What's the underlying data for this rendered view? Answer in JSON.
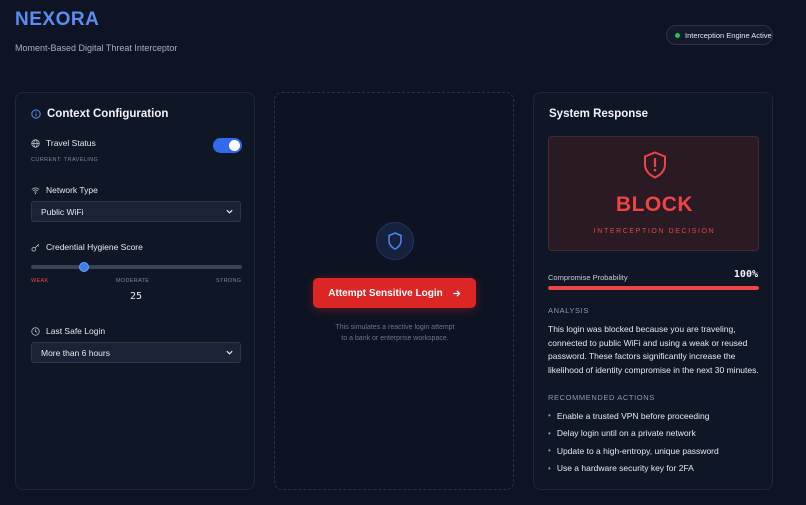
{
  "header": {
    "brand": "NEXORA",
    "tagline": "Moment-Based Digital Threat Interceptor",
    "status": "Interception Engine Active",
    "status_color": "#22c55e"
  },
  "context": {
    "title": "Context Configuration",
    "travel_label": "Travel Status",
    "travel_sub": "CURRENT: TRAVELING",
    "travel_on": true,
    "network_label": "Network Type",
    "network_value": "Public WiFi",
    "hygiene_label": "Credential Hygiene Score",
    "hygiene_score": "25",
    "hygiene_value": 25,
    "scale_weak": "WEAK",
    "scale_moderate": "MODERATE",
    "scale_strong": "STRONG",
    "last_login_label": "Last Safe Login",
    "last_login_value": "More than 6 hours"
  },
  "middle": {
    "button_label": "Attempt Sensitive Login",
    "hint": "This simulates a reactive login attempt to a bank or enterprise workspace."
  },
  "response": {
    "title": "System Response",
    "decision": "BLOCK",
    "decision_sub": "INTERCEPTION DECISION",
    "decision_color": "#ef4444",
    "probability_label": "Compromise Probability",
    "probability_value": "100%",
    "probability_fraction": 1.0,
    "analysis_head": "ANALYSIS",
    "analysis_text": "This login was blocked because you are traveling, connected to public WiFi and using a weak or reused password. These factors significantly increase the likelihood of identity compromise in the next 30 minutes.",
    "actions_head": "RECOMMENDED ACTIONS",
    "actions": [
      "Enable a trusted VPN before proceeding",
      "Delay login until on a private network",
      "Update to a high-entropy, unique password",
      "Use a hardware security key for 2FA"
    ]
  }
}
